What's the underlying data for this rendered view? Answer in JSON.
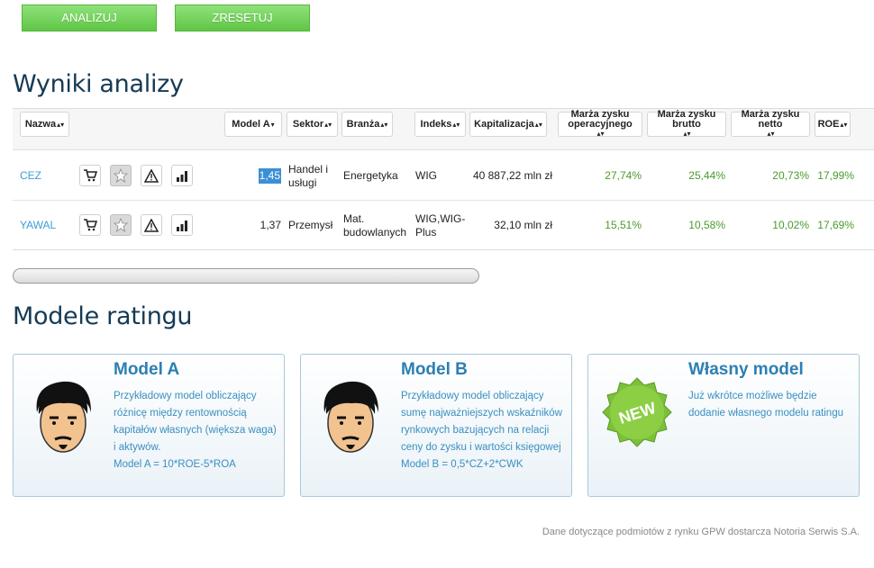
{
  "actions": {
    "analyze_label": "ANALIZUJ",
    "reset_label": "ZRESETUJ"
  },
  "results": {
    "title": "Wyniki analizy",
    "sort_icon": "sort-updown",
    "columns": [
      {
        "label": "Nazwa",
        "sort": "▴▾"
      },
      {
        "label": "Model A",
        "sort": "▾"
      },
      {
        "label": "Sektor",
        "sort": "▴▾"
      },
      {
        "label": "Branża",
        "sort": "▴▾"
      },
      {
        "label": "Indeks",
        "sort": "▴▾"
      },
      {
        "label": "Kapitalizacja",
        "sort": "▴▾"
      },
      {
        "label": "Marża zysku operacyjnego",
        "sort": "▴▾"
      },
      {
        "label": "Marża zysku brutto",
        "sort": "▴▾"
      },
      {
        "label": "Marża zysku netto",
        "sort": "▴▾"
      },
      {
        "label": "ROE",
        "sort": "▴▾"
      }
    ],
    "rows": [
      {
        "name": "CEZ",
        "model_a": "1,45",
        "sector": "Handel i usługi",
        "industry": "Energetyka",
        "index": "WIG",
        "cap": "40 887,22 mln zł",
        "op_margin": "27,74%",
        "gross_margin": "25,44%",
        "net_margin": "20,73%",
        "roe": "17,99%"
      },
      {
        "name": "YAWAL",
        "model_a": "1,37",
        "sector": "Przemysł",
        "industry": "Mat. budowlanych",
        "index": "WIG,WIG-Plus",
        "cap": "32,10 mln zł",
        "op_margin": "15,51%",
        "gross_margin": "10,58%",
        "net_margin": "10,02%",
        "roe": "17,69%"
      }
    ],
    "row_icons": [
      "cart-icon",
      "star-icon",
      "warning-icon",
      "bar-chart-icon"
    ]
  },
  "models": {
    "title": "Modele ratingu",
    "cards": [
      {
        "title": "Model A",
        "desc": "Przykładowy model obliczający różnicę między rentownością kapitałów własnych (większa waga) i aktywów.",
        "formula": "Model A = 10*ROE-5*ROA"
      },
      {
        "title": "Model B",
        "desc": "Przykładowy model obliczający sumę najważniejszych wskaźników rynkowych bazujących na relacji ceny do zysku i wartości księgowej",
        "formula": "Model B = 0,5*CZ+2*CWK"
      },
      {
        "title": "Własny model",
        "desc": "Już wkrótce możliwe będzie dodanie własnego modelu ratingu",
        "badge": "NEW"
      }
    ]
  },
  "footer": "Dane dotyczące podmiotów z rynku GPW dostarcza Notoria Serwis S.A."
}
